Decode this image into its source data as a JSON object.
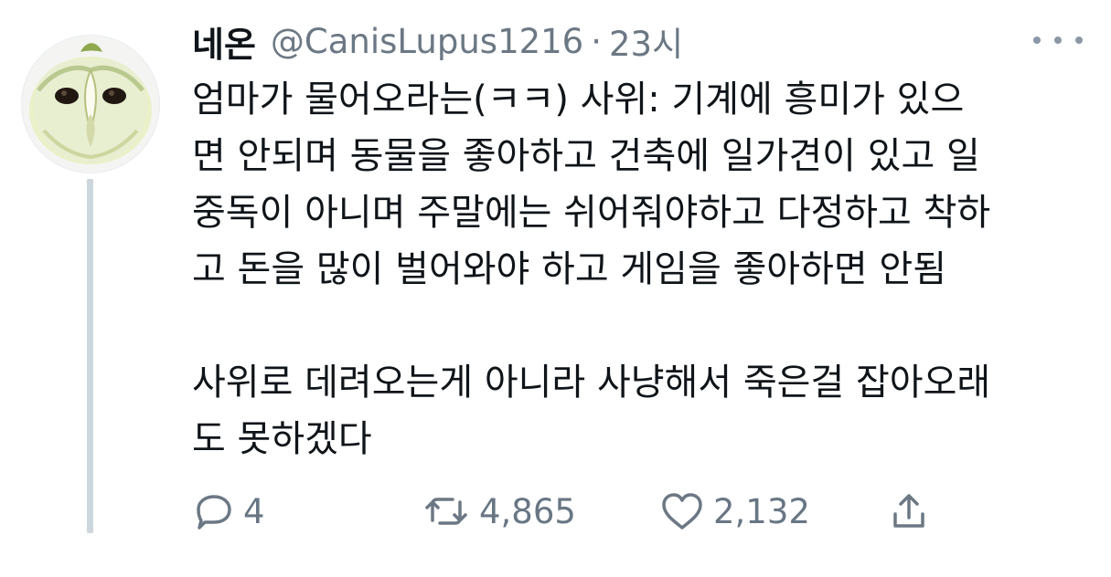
{
  "tweet": {
    "display_name": "네온",
    "handle": "@CanisLupus1216",
    "separator": "·",
    "time": "23시",
    "text_lines": [
      "엄마가 물어오라는(ㅋㅋ) 사위: 기계에 흥미가 있으",
      "면 안되며 동물을 좋아하고 건축에 일가견이 있고 일",
      "중독이 아니며 주말에는 쉬어줘야하고 다정하고 착하",
      "고 돈을 많이 벌어와야 하고 게임을 좋아하면 안됨",
      "",
      "사위로 데려오는게 아니라 사냥해서 죽은걸 잡아오래",
      "도 못하겠다"
    ],
    "counts": {
      "replies": "4",
      "retweets": "4,865",
      "likes": "2,132"
    }
  },
  "icons": {
    "avatar": "owl-apple-avatar",
    "more": "more-horizontal-icon",
    "reply": "reply-icon",
    "retweet": "retweet-icon",
    "like": "heart-icon",
    "share": "share-icon"
  },
  "colors": {
    "text": "#0f1419",
    "secondary": "#6b7884",
    "thread_line": "#ccd6dd",
    "icons": "#6b7884"
  }
}
